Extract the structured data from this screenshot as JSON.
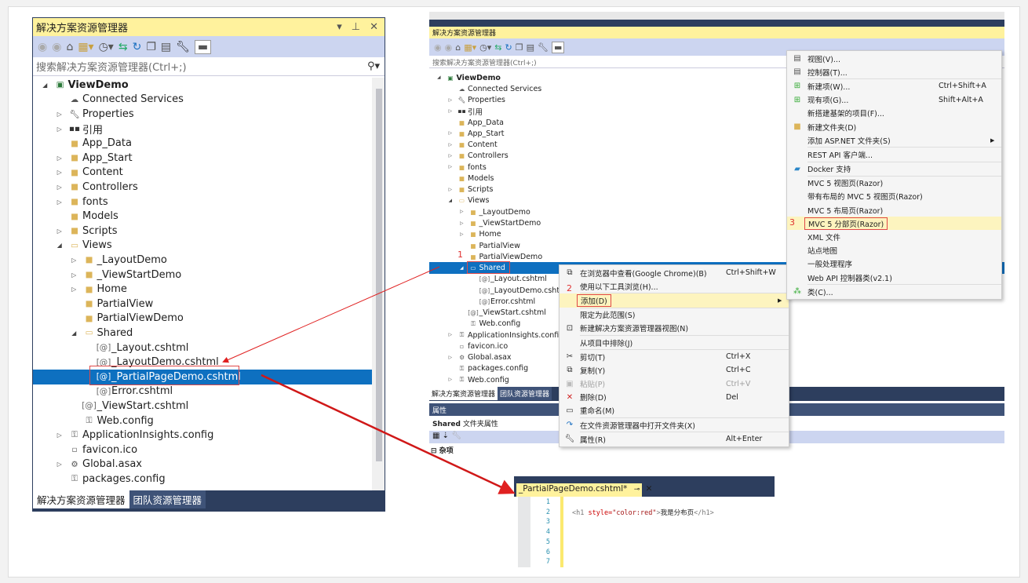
{
  "left_panel": {
    "title": "解决方案资源管理器",
    "title_controls": [
      "▾",
      "ᵖ",
      "✕"
    ],
    "search_placeholder": "搜索解决方案资源管理器(Ctrl+;)",
    "bottom_tabs": [
      "解决方案资源管理器",
      "团队资源管理器"
    ]
  },
  "tree": [
    {
      "label": "ViewDemo",
      "level": 0,
      "exp": "e",
      "icon": "project",
      "bold": true
    },
    {
      "label": "Connected Services",
      "level": 1,
      "icon": "cloud"
    },
    {
      "label": "Properties",
      "level": 1,
      "exp": "c",
      "icon": "wrench"
    },
    {
      "label": "引用",
      "level": 1,
      "exp": "c",
      "icon": "ref"
    },
    {
      "label": "App_Data",
      "level": 1,
      "icon": "folder"
    },
    {
      "label": "App_Start",
      "level": 1,
      "exp": "c",
      "icon": "folder"
    },
    {
      "label": "Content",
      "level": 1,
      "exp": "c",
      "icon": "folder"
    },
    {
      "label": "Controllers",
      "level": 1,
      "exp": "c",
      "icon": "folder"
    },
    {
      "label": "fonts",
      "level": 1,
      "exp": "c",
      "icon": "folder"
    },
    {
      "label": "Models",
      "level": 1,
      "icon": "folder"
    },
    {
      "label": "Scripts",
      "level": 1,
      "exp": "c",
      "icon": "folder"
    },
    {
      "label": "Views",
      "level": 1,
      "exp": "e",
      "icon": "folder-open"
    },
    {
      "label": "_LayoutDemo",
      "level": 2,
      "exp": "c",
      "icon": "folder"
    },
    {
      "label": "_ViewStartDemo",
      "level": 2,
      "exp": "c",
      "icon": "folder"
    },
    {
      "label": "Home",
      "level": 2,
      "exp": "c",
      "icon": "folder"
    },
    {
      "label": "PartialView",
      "level": 2,
      "icon": "folder"
    },
    {
      "label": "PartialViewDemo",
      "level": 2,
      "icon": "folder"
    },
    {
      "label": "Shared",
      "level": 2,
      "exp": "e",
      "icon": "folder-open"
    },
    {
      "label": "_Layout.cshtml",
      "level": 3,
      "icon": "razor"
    },
    {
      "label": "_LayoutDemo.cshtml",
      "level": 3,
      "icon": "razor"
    },
    {
      "label": "_PartialPageDemo.cshtml",
      "level": 3,
      "icon": "razor",
      "selected": true
    },
    {
      "label": "Error.cshtml",
      "level": 3,
      "icon": "razor"
    },
    {
      "label": "_ViewStart.cshtml",
      "level": 2,
      "icon": "razor"
    },
    {
      "label": "Web.config",
      "level": 2,
      "icon": "config"
    },
    {
      "label": "ApplicationInsights.config",
      "level": 1,
      "exp": "c",
      "icon": "config"
    },
    {
      "label": "favicon.ico",
      "level": 1,
      "icon": "file"
    },
    {
      "label": "Global.asax",
      "level": 1,
      "exp": "c",
      "icon": "asax"
    },
    {
      "label": "packages.config",
      "level": 1,
      "icon": "config"
    }
  ],
  "right_panel": {
    "title": "解决方案资源管理器",
    "search_placeholder": "搜索解决方案资源管理器(Ctrl+;)",
    "bottom_tabs": [
      "解决方案资源管理器",
      "团队资源管理器"
    ],
    "properties": {
      "header": "属性",
      "object": "Shared",
      "object_type": "文件夹属性",
      "category": "杂项"
    }
  },
  "tree_right": [
    {
      "label": "ViewDemo",
      "level": 0,
      "exp": "e",
      "icon": "project",
      "bold": true
    },
    {
      "label": "Connected Services",
      "level": 1,
      "icon": "cloud"
    },
    {
      "label": "Properties",
      "level": 1,
      "exp": "c",
      "icon": "wrench"
    },
    {
      "label": "引用",
      "level": 1,
      "exp": "c",
      "icon": "ref"
    },
    {
      "label": "App_Data",
      "level": 1,
      "icon": "folder"
    },
    {
      "label": "App_Start",
      "level": 1,
      "exp": "c",
      "icon": "folder"
    },
    {
      "label": "Content",
      "level": 1,
      "exp": "c",
      "icon": "folder"
    },
    {
      "label": "Controllers",
      "level": 1,
      "exp": "c",
      "icon": "folder"
    },
    {
      "label": "fonts",
      "level": 1,
      "exp": "c",
      "icon": "folder"
    },
    {
      "label": "Models",
      "level": 1,
      "icon": "folder"
    },
    {
      "label": "Scripts",
      "level": 1,
      "exp": "c",
      "icon": "folder"
    },
    {
      "label": "Views",
      "level": 1,
      "exp": "e",
      "icon": "folder-open"
    },
    {
      "label": "_LayoutDemo",
      "level": 2,
      "exp": "c",
      "icon": "folder"
    },
    {
      "label": "_ViewStartDemo",
      "level": 2,
      "exp": "c",
      "icon": "folder"
    },
    {
      "label": "Home",
      "level": 2,
      "exp": "c",
      "icon": "folder"
    },
    {
      "label": "PartialView",
      "level": 2,
      "icon": "folder"
    },
    {
      "label": "PartialViewDemo",
      "level": 2,
      "icon": "folder"
    },
    {
      "label": "Shared",
      "level": 2,
      "exp": "e",
      "icon": "folder-open",
      "selected": true
    },
    {
      "label": "_Layout.cshtml",
      "level": 3,
      "icon": "razor"
    },
    {
      "label": "_LayoutDemo.cshtml",
      "level": 3,
      "icon": "razor"
    },
    {
      "label": "Error.cshtml",
      "level": 3,
      "icon": "razor"
    },
    {
      "label": "_ViewStart.cshtml",
      "level": 2,
      "icon": "razor"
    },
    {
      "label": "Web.config",
      "level": 2,
      "icon": "config"
    },
    {
      "label": "ApplicationInsights.config",
      "level": 1,
      "exp": "c",
      "icon": "config"
    },
    {
      "label": "favicon.ico",
      "level": 1,
      "icon": "file"
    },
    {
      "label": "Global.asax",
      "level": 1,
      "exp": "c",
      "icon": "asax"
    },
    {
      "label": "packages.config",
      "level": 1,
      "icon": "config"
    },
    {
      "label": "Web.config",
      "level": 1,
      "exp": "c",
      "icon": "config"
    }
  ],
  "context_menu": [
    {
      "icon": "browser",
      "label": "在浏览器中查看(Google Chrome)(B)",
      "shortcut": "Ctrl+Shift+W"
    },
    {
      "label": "使用以下工具浏览(H)..."
    },
    {
      "sep": true
    },
    {
      "label": "添加(D)",
      "submenu": true,
      "highlight": true
    },
    {
      "sep": true
    },
    {
      "label": "限定为此范围(S)"
    },
    {
      "icon": "new-view",
      "label": "新建解决方案资源管理器视图(N)"
    },
    {
      "sep": true
    },
    {
      "label": "从项目中排除(J)"
    },
    {
      "sep": true
    },
    {
      "icon": "cut",
      "label": "剪切(T)",
      "shortcut": "Ctrl+X"
    },
    {
      "icon": "copy",
      "label": "复制(Y)",
      "shortcut": "Ctrl+C"
    },
    {
      "icon": "paste",
      "label": "粘贴(P)",
      "shortcut": "Ctrl+V",
      "disabled": true
    },
    {
      "icon": "delete",
      "label": "删除(D)",
      "shortcut": "Del"
    },
    {
      "icon": "rename",
      "label": "重命名(M)"
    },
    {
      "sep": true
    },
    {
      "icon": "open-folder",
      "label": "在文件资源管理器中打开文件夹(X)"
    },
    {
      "sep": true
    },
    {
      "icon": "wrench",
      "label": "属性(R)",
      "shortcut": "Alt+Enter"
    }
  ],
  "add_submenu": [
    {
      "icon": "doc",
      "label": "视图(V)..."
    },
    {
      "icon": "doc",
      "label": "控制器(T)..."
    },
    {
      "sep": true
    },
    {
      "icon": "new-item",
      "label": "新建项(W)...",
      "shortcut": "Ctrl+Shift+A"
    },
    {
      "icon": "new-item",
      "label": "现有项(G)...",
      "shortcut": "Shift+Alt+A"
    },
    {
      "label": "新搭建基架的项目(F)..."
    },
    {
      "icon": "folder",
      "label": "新建文件夹(D)"
    },
    {
      "label": "添加 ASP.NET 文件夹(S)",
      "submenu": true
    },
    {
      "sep": true
    },
    {
      "label": "REST API 客户端..."
    },
    {
      "sep": true
    },
    {
      "icon": "docker",
      "label": "Docker 支持"
    },
    {
      "sep": true
    },
    {
      "label": "MVC 5 视图页(Razor)"
    },
    {
      "label": "带有布局的 MVC 5 视图页(Razor)"
    },
    {
      "label": "MVC 5 布局页(Razor)"
    },
    {
      "label": "MVC 5 分部页(Razor)",
      "highlight": true
    },
    {
      "label": "XML 文件"
    },
    {
      "label": "站点地图"
    },
    {
      "label": "一般处理程序"
    },
    {
      "label": "Web API 控制器类(v2.1)"
    },
    {
      "sep": true
    },
    {
      "icon": "class",
      "label": "类(C)..."
    }
  ],
  "editor": {
    "tab_label": "_PartialPageDemo.cshtml*",
    "line_numbers": [
      "1",
      "2",
      "3",
      "4",
      "5",
      "6",
      "7"
    ],
    "code": {
      "open": "<h1 ",
      "attr": "style=",
      "val": "\"color:red\"",
      "gt": ">",
      "text": "我是分布页",
      "close": "</h1>"
    }
  },
  "annotations": [
    "1",
    "2",
    "3"
  ],
  "colors": {
    "title_yellow": "#fff29d",
    "selection": "#0e70c0",
    "annotation_red": "#e03030",
    "dark_chrome": "#2d3e5e"
  }
}
